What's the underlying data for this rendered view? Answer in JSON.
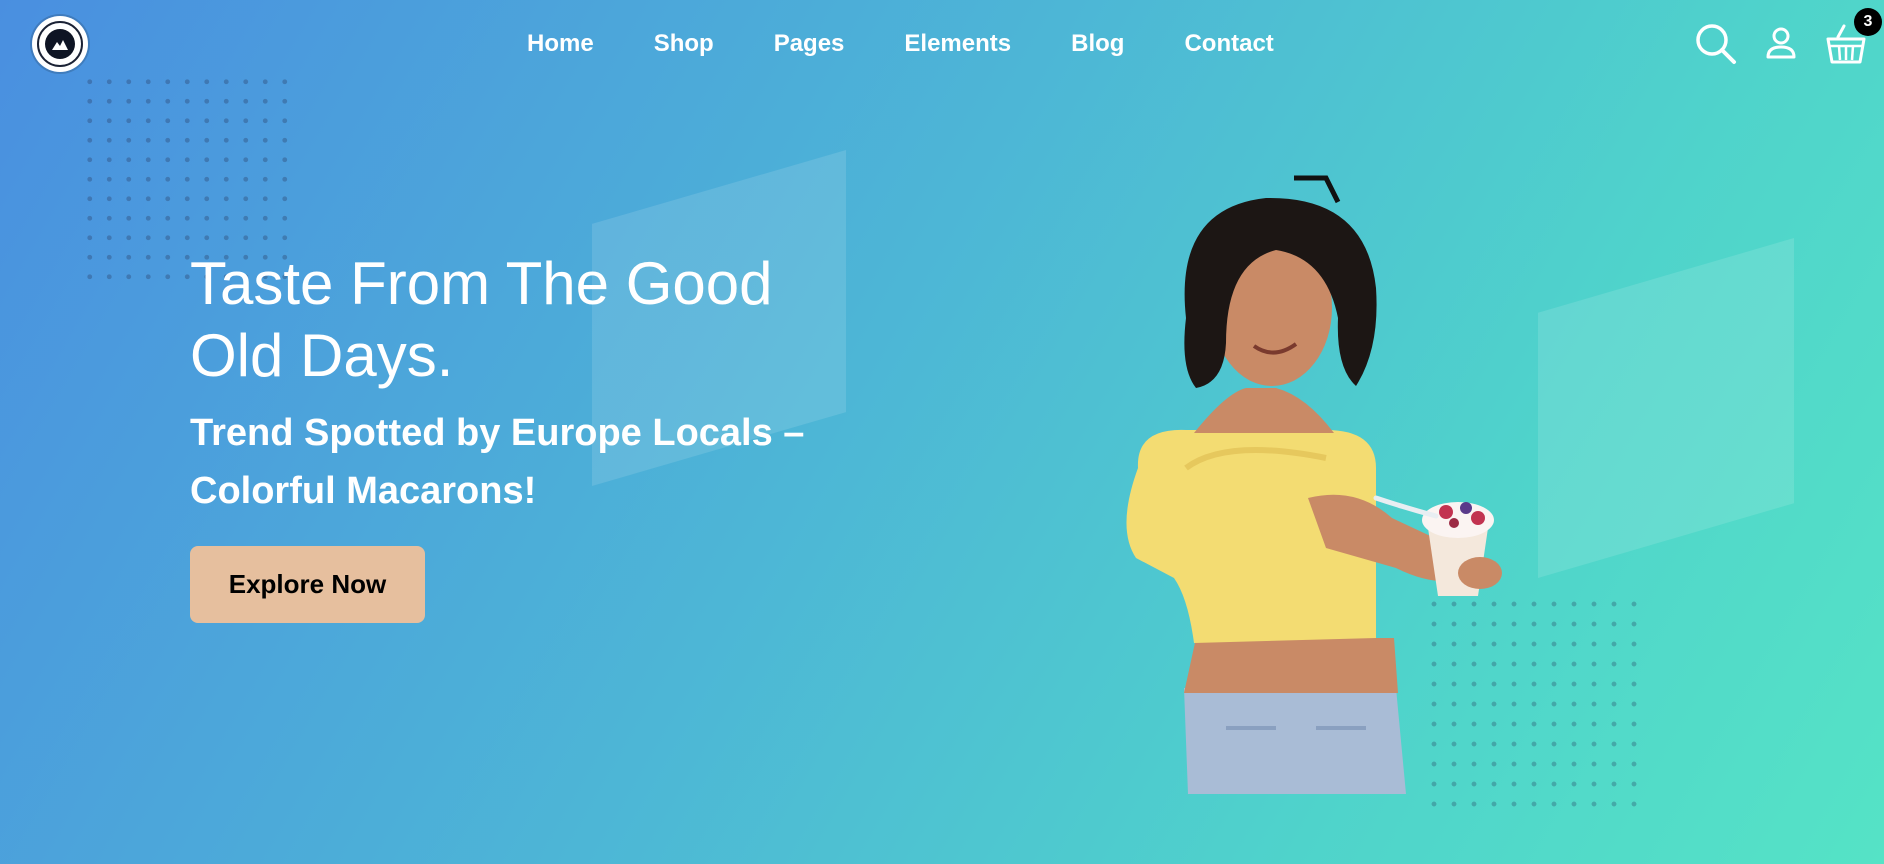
{
  "header": {
    "logo_icon": "brand-badge-icon",
    "nav": [
      {
        "label": "Home"
      },
      {
        "label": "Shop"
      },
      {
        "label": "Pages"
      },
      {
        "label": "Elements"
      },
      {
        "label": "Blog"
      },
      {
        "label": "Contact"
      }
    ],
    "icons": {
      "search": "search-icon",
      "account": "user-icon",
      "cart": "basket-icon"
    },
    "cart_count": "3"
  },
  "hero": {
    "headline": "Taste From The Good Old Days.",
    "subheadline": "Trend Spotted by Europe Locals – Colorful Macarons!",
    "cta_label": "Explore Now",
    "image": "woman-in-yellow-top-eating-frozen-yogurt"
  },
  "colors": {
    "gradient_start": "#4a8fe0",
    "gradient_end": "#55e3c6",
    "cta_background": "#e6bf9e",
    "text": "#ffffff",
    "badge": "#000000"
  }
}
